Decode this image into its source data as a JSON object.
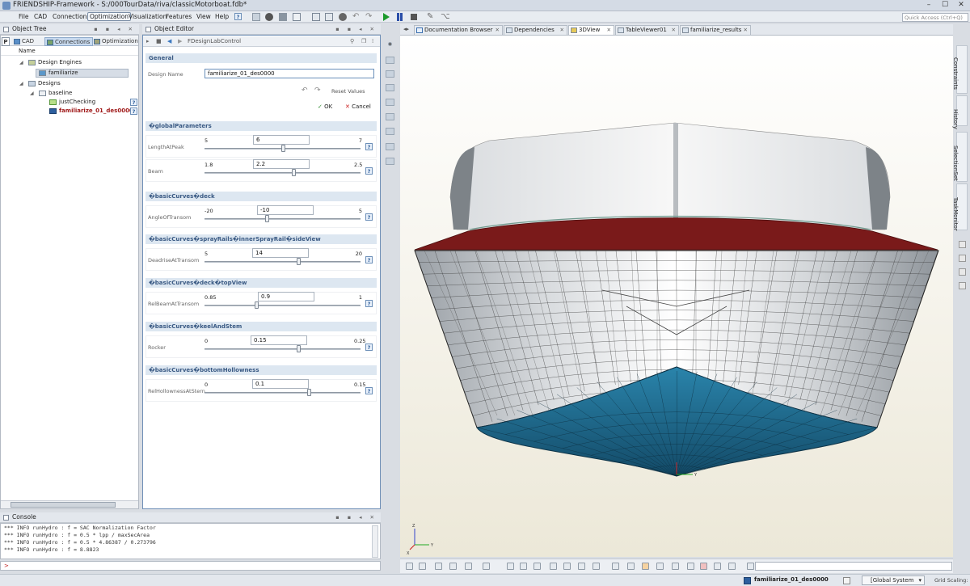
{
  "window": {
    "title": "FRIENDSHIP-Framework - S:/000TourData/riva/classicMotorboat.fdb*",
    "min": "–",
    "max": "☐",
    "close": "✕"
  },
  "menu": [
    "File",
    "CAD",
    "Connections",
    "Optimization",
    "Visualization",
    "Features",
    "View",
    "Help"
  ],
  "quick_access": {
    "placeholder": "Quick Access (Ctrl+Q)"
  },
  "object_tree": {
    "title": "Object Tree",
    "tabs": [
      "CAD",
      "Connections",
      "Optimization"
    ],
    "column_header": "Name",
    "items": {
      "design_engines": "Design Engines",
      "familiarize": "familiarize",
      "designs": "Designs",
      "baseline": "baseline",
      "just_checking": "justChecking",
      "familiarize_des": "familiarize_01_des0000"
    }
  },
  "object_editor": {
    "title": "Object Editor",
    "control_name": "FDesignLabControl",
    "general": "General",
    "design_name_label": "Design Name",
    "design_name_value": "familiarize_01_des0000",
    "reset_values": "Reset Values",
    "ok": "OK",
    "cancel": "Cancel",
    "sections": [
      {
        "title": "�globalParameters"
      },
      {
        "title": "�basicCurves�deck"
      },
      {
        "title": "�basicCurves�sprayRails�innerSprayRail�sideView"
      },
      {
        "title": "�basicCurves�deck�topView"
      },
      {
        "title": "�basicCurves�keelAndStem"
      },
      {
        "title": "�basicCurves�bottomHollowness"
      }
    ],
    "params": [
      {
        "label": "LengthAtPeak",
        "min": "5",
        "max": "7",
        "value": "6",
        "frac": 0.5
      },
      {
        "label": "Beam",
        "min": "1.8",
        "max": "2.5",
        "value": "2.2",
        "frac": 0.57
      },
      {
        "label": "AngleOfTransom",
        "min": "-20",
        "max": "5",
        "value": "-10",
        "frac": 0.4
      },
      {
        "label": "DeadriseAtTransom",
        "min": "5",
        "max": "20",
        "value": "14",
        "frac": 0.6
      },
      {
        "label": "RelBeamAtTransom",
        "min": "0.85",
        "max": "1",
        "value": "0.9",
        "frac": 0.33
      },
      {
        "label": "Rocker",
        "min": "0",
        "max": "0.25",
        "value": "0.15",
        "frac": 0.6
      },
      {
        "label": "RelHollownessAtStern",
        "min": "0",
        "max": "0.15",
        "value": "0.1",
        "frac": 0.67
      }
    ]
  },
  "view_tabs": [
    "Documentation Browser",
    "Dependencies",
    "3DView",
    "TableViewer01",
    "familiarize_results"
  ],
  "right_sidebar": [
    "Constraints",
    "History",
    "SelectionSet",
    "TaskMonitor"
  ],
  "console": {
    "title": "Console",
    "lines": [
      "*** INFO runHydro : f = SAC Normalization Factor",
      "*** INFO runHydro : f = 0.5 * lpp / maxSecArea",
      "*** INFO runHydro : f = 0.5 * 4.86387 / 0.273796",
      "*** INFO runHydro : f = 8.8823"
    ],
    "prompt": ">"
  },
  "status": {
    "current_design": "familiarize_01_des0000",
    "coord_system": "[Global System",
    "grid_scaling": "Grid Scaling:"
  },
  "axes": {
    "x": "X",
    "y": "Y",
    "z": "Z"
  },
  "colors": {
    "hull_bottom": "#1e6f95",
    "deck_red": "#7a1a1a",
    "accent_blue": "#3b78c0",
    "cancel_red": "#cc2222",
    "ok_green": "#2e8b2e"
  }
}
